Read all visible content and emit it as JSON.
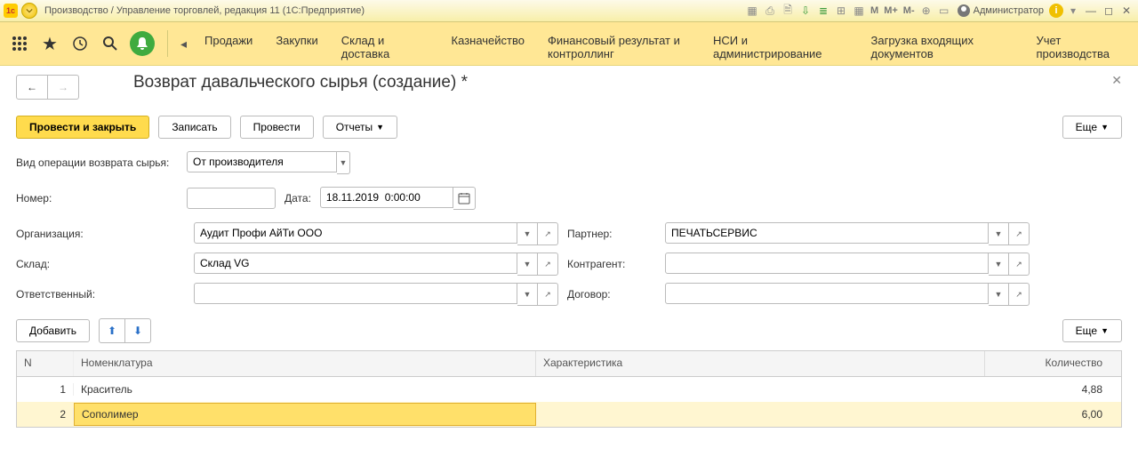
{
  "titlebar": {
    "title": "Производство / Управление торговлей, редакция 11  (1С:Предприятие)",
    "m": "M",
    "mp": "M+",
    "mm": "M-",
    "user": "Администратор"
  },
  "nav": {
    "items": [
      "Продажи",
      "Закупки",
      "Склад и доставка",
      "Казначейство",
      "Финансовый результат и контроллинг",
      "НСИ и администрирование",
      "Загрузка входящих документов",
      "Учет производства"
    ]
  },
  "page": {
    "title": "Возврат давальческого сырья (создание) *"
  },
  "cmd": {
    "post_close": "Провести и закрыть",
    "save": "Записать",
    "post": "Провести",
    "reports": "Отчеты",
    "more": "Еще"
  },
  "form": {
    "op_type_label": "Вид операции возврата сырья:",
    "op_type_value": "От производителя",
    "number_label": "Номер:",
    "number_value": "",
    "date_label": "Дата:",
    "date_value": "18.11.2019  0:00:00",
    "org_label": "Организация:",
    "org_value": "Аудит Профи АйТи ООО",
    "partner_label": "Партнер:",
    "partner_value": "ПЕЧАТЬСЕРВИС",
    "store_label": "Склад:",
    "store_value": "Склад VG",
    "contragent_label": "Контрагент:",
    "contragent_value": "",
    "resp_label": "Ответственный:",
    "resp_value": "",
    "contract_label": "Договор:",
    "contract_value": ""
  },
  "tbl_cmd": {
    "add": "Добавить",
    "more": "Еще"
  },
  "table": {
    "headers": {
      "n": "N",
      "nom": "Номенклатура",
      "char": "Характеристика",
      "qty": "Количество"
    },
    "rows": [
      {
        "n": "1",
        "nom": "Краситель",
        "char": "",
        "qty": "4,88"
      },
      {
        "n": "2",
        "nom": "Сополимер",
        "char": "",
        "qty": "6,00"
      }
    ]
  }
}
